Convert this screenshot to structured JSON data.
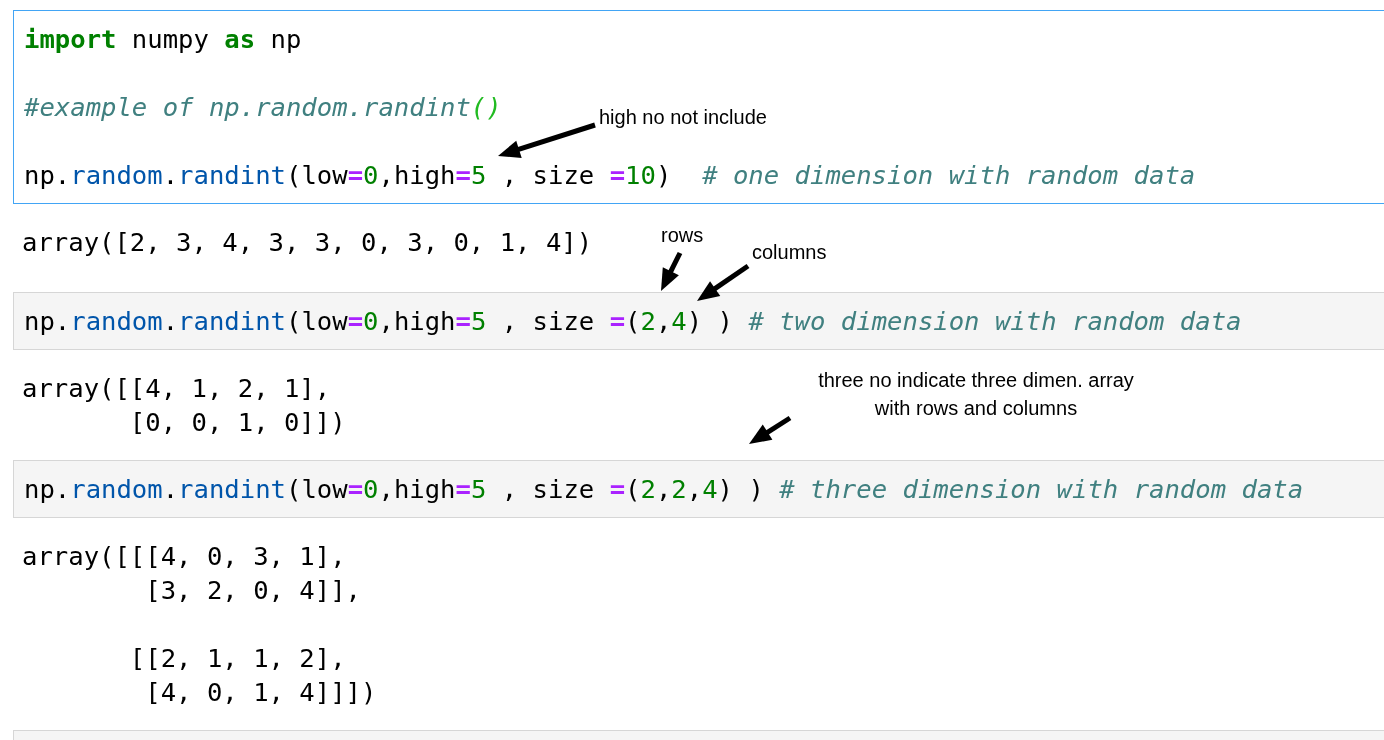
{
  "cells": [
    {
      "selected": true,
      "blocks": [
        [
          {
            "tokens": [
              {
                "kind": "keyword",
                "text": "import"
              },
              {
                "kind": "plain",
                "text": " numpy "
              },
              {
                "kind": "keyword",
                "text": "as"
              },
              {
                "kind": "plain",
                "text": " np"
              }
            ]
          }
        ],
        [
          {
            "tokens": [
              {
                "kind": "comment",
                "text": "#example of np.random.randint"
              },
              {
                "kind": "bracket",
                "text": "()"
              }
            ]
          }
        ],
        [
          {
            "tokens": [
              {
                "kind": "plain",
                "text": "np."
              },
              {
                "kind": "property",
                "text": "random"
              },
              {
                "kind": "plain",
                "text": "."
              },
              {
                "kind": "property",
                "text": "randint"
              },
              {
                "kind": "plain",
                "text": "(low"
              },
              {
                "kind": "operator",
                "text": "="
              },
              {
                "kind": "number",
                "text": "0"
              },
              {
                "kind": "plain",
                "text": ",high"
              },
              {
                "kind": "operator",
                "text": "="
              },
              {
                "kind": "number",
                "text": "5"
              },
              {
                "kind": "plain",
                "text": " , size "
              },
              {
                "kind": "operator",
                "text": "="
              },
              {
                "kind": "number",
                "text": "10"
              },
              {
                "kind": "plain",
                "text": ")  "
              },
              {
                "kind": "comment",
                "text": "# one dimension with random data"
              }
            ]
          }
        ]
      ],
      "output": "array([2, 3, 4, 3, 3, 0, 3, 0, 1, 4])"
    },
    {
      "selected": false,
      "blocks": [
        [
          {
            "tokens": [
              {
                "kind": "plain",
                "text": "np."
              },
              {
                "kind": "property",
                "text": "random"
              },
              {
                "kind": "plain",
                "text": "."
              },
              {
                "kind": "property",
                "text": "randint"
              },
              {
                "kind": "plain",
                "text": "(low"
              },
              {
                "kind": "operator",
                "text": "="
              },
              {
                "kind": "number",
                "text": "0"
              },
              {
                "kind": "plain",
                "text": ",high"
              },
              {
                "kind": "operator",
                "text": "="
              },
              {
                "kind": "number",
                "text": "5"
              },
              {
                "kind": "plain",
                "text": " , size "
              },
              {
                "kind": "operator",
                "text": "="
              },
              {
                "kind": "plain",
                "text": "("
              },
              {
                "kind": "number",
                "text": "2"
              },
              {
                "kind": "plain",
                "text": ","
              },
              {
                "kind": "number",
                "text": "4"
              },
              {
                "kind": "plain",
                "text": ") ) "
              },
              {
                "kind": "comment",
                "text": "# two dimension with random data"
              }
            ]
          }
        ]
      ],
      "output": "array([[4, 1, 2, 1],\n       [0, 0, 1, 0]])"
    },
    {
      "selected": false,
      "blocks": [
        [
          {
            "tokens": [
              {
                "kind": "plain",
                "text": "np."
              },
              {
                "kind": "property",
                "text": "random"
              },
              {
                "kind": "plain",
                "text": "."
              },
              {
                "kind": "property",
                "text": "randint"
              },
              {
                "kind": "plain",
                "text": "(low"
              },
              {
                "kind": "operator",
                "text": "="
              },
              {
                "kind": "number",
                "text": "0"
              },
              {
                "kind": "plain",
                "text": ",high"
              },
              {
                "kind": "operator",
                "text": "="
              },
              {
                "kind": "number",
                "text": "5"
              },
              {
                "kind": "plain",
                "text": " , size "
              },
              {
                "kind": "operator",
                "text": "="
              },
              {
                "kind": "plain",
                "text": "("
              },
              {
                "kind": "number",
                "text": "2"
              },
              {
                "kind": "plain",
                "text": ","
              },
              {
                "kind": "number",
                "text": "2"
              },
              {
                "kind": "plain",
                "text": ","
              },
              {
                "kind": "number",
                "text": "4"
              },
              {
                "kind": "plain",
                "text": ") ) "
              },
              {
                "kind": "comment",
                "text": "# three dimension with random data"
              }
            ]
          }
        ]
      ],
      "output": "array([[[4, 0, 3, 1],\n        [3, 2, 0, 4]],\n\n       [[2, 1, 1, 2],\n        [4, 0, 1, 4]]])"
    },
    {
      "selected": false
    }
  ],
  "annotations": [
    {
      "text": "high no not include"
    },
    {
      "text": "rows"
    },
    {
      "text": "columns"
    },
    {
      "text": "three no indicate three dimen. array\nwith rows and columns"
    }
  ]
}
